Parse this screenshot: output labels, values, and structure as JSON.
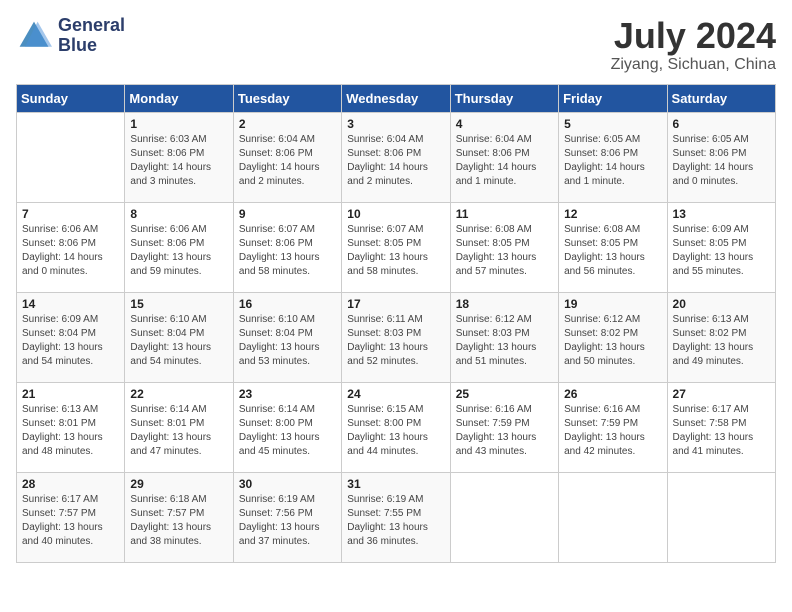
{
  "header": {
    "logo_line1": "General",
    "logo_line2": "Blue",
    "month_year": "July 2024",
    "location": "Ziyang, Sichuan, China"
  },
  "days_of_week": [
    "Sunday",
    "Monday",
    "Tuesday",
    "Wednesday",
    "Thursday",
    "Friday",
    "Saturday"
  ],
  "weeks": [
    [
      {
        "num": "",
        "sunrise": "",
        "sunset": "",
        "daylight": ""
      },
      {
        "num": "1",
        "sunrise": "Sunrise: 6:03 AM",
        "sunset": "Sunset: 8:06 PM",
        "daylight": "Daylight: 14 hours and 3 minutes."
      },
      {
        "num": "2",
        "sunrise": "Sunrise: 6:04 AM",
        "sunset": "Sunset: 8:06 PM",
        "daylight": "Daylight: 14 hours and 2 minutes."
      },
      {
        "num": "3",
        "sunrise": "Sunrise: 6:04 AM",
        "sunset": "Sunset: 8:06 PM",
        "daylight": "Daylight: 14 hours and 2 minutes."
      },
      {
        "num": "4",
        "sunrise": "Sunrise: 6:04 AM",
        "sunset": "Sunset: 8:06 PM",
        "daylight": "Daylight: 14 hours and 1 minute."
      },
      {
        "num": "5",
        "sunrise": "Sunrise: 6:05 AM",
        "sunset": "Sunset: 8:06 PM",
        "daylight": "Daylight: 14 hours and 1 minute."
      },
      {
        "num": "6",
        "sunrise": "Sunrise: 6:05 AM",
        "sunset": "Sunset: 8:06 PM",
        "daylight": "Daylight: 14 hours and 0 minutes."
      }
    ],
    [
      {
        "num": "7",
        "sunrise": "Sunrise: 6:06 AM",
        "sunset": "Sunset: 8:06 PM",
        "daylight": "Daylight: 14 hours and 0 minutes."
      },
      {
        "num": "8",
        "sunrise": "Sunrise: 6:06 AM",
        "sunset": "Sunset: 8:06 PM",
        "daylight": "Daylight: 13 hours and 59 minutes."
      },
      {
        "num": "9",
        "sunrise": "Sunrise: 6:07 AM",
        "sunset": "Sunset: 8:06 PM",
        "daylight": "Daylight: 13 hours and 58 minutes."
      },
      {
        "num": "10",
        "sunrise": "Sunrise: 6:07 AM",
        "sunset": "Sunset: 8:05 PM",
        "daylight": "Daylight: 13 hours and 58 minutes."
      },
      {
        "num": "11",
        "sunrise": "Sunrise: 6:08 AM",
        "sunset": "Sunset: 8:05 PM",
        "daylight": "Daylight: 13 hours and 57 minutes."
      },
      {
        "num": "12",
        "sunrise": "Sunrise: 6:08 AM",
        "sunset": "Sunset: 8:05 PM",
        "daylight": "Daylight: 13 hours and 56 minutes."
      },
      {
        "num": "13",
        "sunrise": "Sunrise: 6:09 AM",
        "sunset": "Sunset: 8:05 PM",
        "daylight": "Daylight: 13 hours and 55 minutes."
      }
    ],
    [
      {
        "num": "14",
        "sunrise": "Sunrise: 6:09 AM",
        "sunset": "Sunset: 8:04 PM",
        "daylight": "Daylight: 13 hours and 54 minutes."
      },
      {
        "num": "15",
        "sunrise": "Sunrise: 6:10 AM",
        "sunset": "Sunset: 8:04 PM",
        "daylight": "Daylight: 13 hours and 54 minutes."
      },
      {
        "num": "16",
        "sunrise": "Sunrise: 6:10 AM",
        "sunset": "Sunset: 8:04 PM",
        "daylight": "Daylight: 13 hours and 53 minutes."
      },
      {
        "num": "17",
        "sunrise": "Sunrise: 6:11 AM",
        "sunset": "Sunset: 8:03 PM",
        "daylight": "Daylight: 13 hours and 52 minutes."
      },
      {
        "num": "18",
        "sunrise": "Sunrise: 6:12 AM",
        "sunset": "Sunset: 8:03 PM",
        "daylight": "Daylight: 13 hours and 51 minutes."
      },
      {
        "num": "19",
        "sunrise": "Sunrise: 6:12 AM",
        "sunset": "Sunset: 8:02 PM",
        "daylight": "Daylight: 13 hours and 50 minutes."
      },
      {
        "num": "20",
        "sunrise": "Sunrise: 6:13 AM",
        "sunset": "Sunset: 8:02 PM",
        "daylight": "Daylight: 13 hours and 49 minutes."
      }
    ],
    [
      {
        "num": "21",
        "sunrise": "Sunrise: 6:13 AM",
        "sunset": "Sunset: 8:01 PM",
        "daylight": "Daylight: 13 hours and 48 minutes."
      },
      {
        "num": "22",
        "sunrise": "Sunrise: 6:14 AM",
        "sunset": "Sunset: 8:01 PM",
        "daylight": "Daylight: 13 hours and 47 minutes."
      },
      {
        "num": "23",
        "sunrise": "Sunrise: 6:14 AM",
        "sunset": "Sunset: 8:00 PM",
        "daylight": "Daylight: 13 hours and 45 minutes."
      },
      {
        "num": "24",
        "sunrise": "Sunrise: 6:15 AM",
        "sunset": "Sunset: 8:00 PM",
        "daylight": "Daylight: 13 hours and 44 minutes."
      },
      {
        "num": "25",
        "sunrise": "Sunrise: 6:16 AM",
        "sunset": "Sunset: 7:59 PM",
        "daylight": "Daylight: 13 hours and 43 minutes."
      },
      {
        "num": "26",
        "sunrise": "Sunrise: 6:16 AM",
        "sunset": "Sunset: 7:59 PM",
        "daylight": "Daylight: 13 hours and 42 minutes."
      },
      {
        "num": "27",
        "sunrise": "Sunrise: 6:17 AM",
        "sunset": "Sunset: 7:58 PM",
        "daylight": "Daylight: 13 hours and 41 minutes."
      }
    ],
    [
      {
        "num": "28",
        "sunrise": "Sunrise: 6:17 AM",
        "sunset": "Sunset: 7:57 PM",
        "daylight": "Daylight: 13 hours and 40 minutes."
      },
      {
        "num": "29",
        "sunrise": "Sunrise: 6:18 AM",
        "sunset": "Sunset: 7:57 PM",
        "daylight": "Daylight: 13 hours and 38 minutes."
      },
      {
        "num": "30",
        "sunrise": "Sunrise: 6:19 AM",
        "sunset": "Sunset: 7:56 PM",
        "daylight": "Daylight: 13 hours and 37 minutes."
      },
      {
        "num": "31",
        "sunrise": "Sunrise: 6:19 AM",
        "sunset": "Sunset: 7:55 PM",
        "daylight": "Daylight: 13 hours and 36 minutes."
      },
      {
        "num": "",
        "sunrise": "",
        "sunset": "",
        "daylight": ""
      },
      {
        "num": "",
        "sunrise": "",
        "sunset": "",
        "daylight": ""
      },
      {
        "num": "",
        "sunrise": "",
        "sunset": "",
        "daylight": ""
      }
    ]
  ]
}
